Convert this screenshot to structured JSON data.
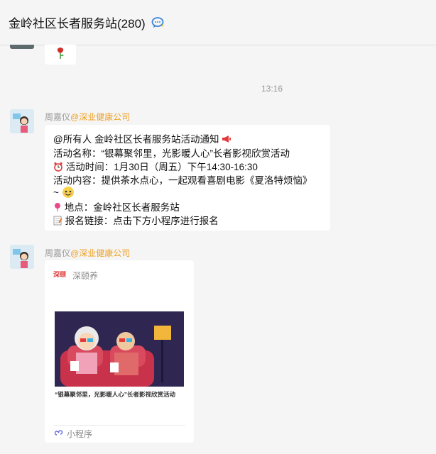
{
  "header": {
    "title": "金岭社区长者服务站(280)",
    "chat_icon": "chat-bubble-icon"
  },
  "prev_message": {
    "emoji": "rose-icon"
  },
  "timestamp": "13:16",
  "messages": [
    {
      "sender_name": "周嘉仪",
      "sender_org": "@深业健康公司",
      "lines": [
        "@所有人 金岭社区长者服务站活动通知",
        "活动名称：“银幕聚邻里，光影暖人心”长者影视欣赏活动",
        "活动时间：1月30日（周五）下午14:30-16:30",
        "活动内容：提供茶水点心，一起观看喜剧电影《夏洛特烦恼》",
        "~",
        "地点：金岭社区长者服务站",
        "报名链接：点击下方小程序进行报名"
      ]
    },
    {
      "sender_name": "周嘉仪",
      "sender_org": "@深业健康公司",
      "card": {
        "app_name": "深颐养",
        "logo_text": "深颐",
        "caption": "“银幕聚邻里，光影暖人心”长者影视欣赏活动",
        "footer_label": "小程序"
      }
    }
  ],
  "colors": {
    "background": "#f5f5f5",
    "org_accent": "#f0a020",
    "card_image_bg": "#2f2752"
  }
}
